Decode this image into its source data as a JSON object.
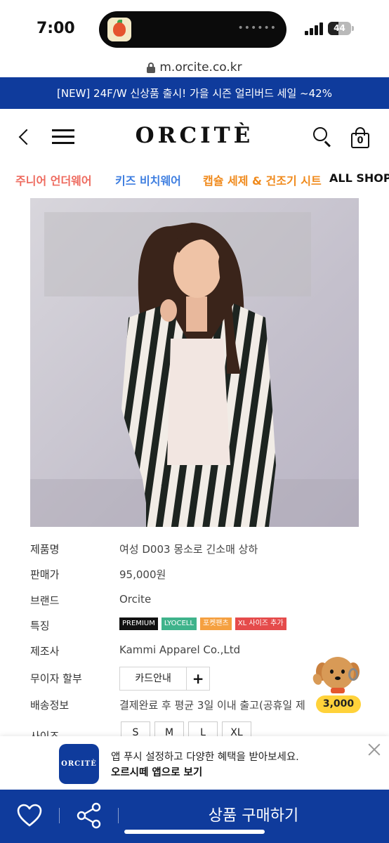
{
  "status_bar": {
    "time": "7:00",
    "battery": "44",
    "battery_fraction": 0.44
  },
  "browser": {
    "url": "m.orcite.co.kr"
  },
  "promo": {
    "text": "[NEW] 24F/W 신상품 출시! 가을 시즌 얼리버드 세일 ~42%"
  },
  "header": {
    "logo": "ORCITÈ",
    "cart_count": "0"
  },
  "categories": [
    {
      "label": "주니어 언더웨어",
      "color": "#ee6b5f"
    },
    {
      "label": "키즈 비치웨어",
      "color": "#3e7ee0"
    },
    {
      "label": "캡슐 세제 & 건조기 시트",
      "color": "#f08a1c"
    },
    {
      "label": "ALL SHOP",
      "color": "#111111"
    }
  ],
  "product": {
    "name_label": "제품명",
    "name": "여성 D003 몽소로 긴소매 상하",
    "price_label": "판매가",
    "price": "95,000원",
    "brand_label": "브랜드",
    "brand": "Orcite",
    "features_label": "특징",
    "features": [
      {
        "label": "PREMIUM",
        "color": "#111111"
      },
      {
        "label": "LYOCELL",
        "color": "#3fb38b"
      },
      {
        "label": "포켓팬츠",
        "color": "#f5a040"
      },
      {
        "label": "XL 사이즈 추가",
        "color": "#e54b4b"
      }
    ],
    "maker_label": "제조사",
    "maker": "Kammi Apparel Co.,Ltd",
    "installment_label": "무이자 할부",
    "card_button": "카드안내",
    "plus_symbol": "+",
    "shipping_label": "배송정보",
    "shipping": "결제완료 후 평균 3일 이내 출고(공휴일 제",
    "size_label": "사이즈",
    "sizes": [
      "S",
      "M",
      "L",
      "XL"
    ]
  },
  "mascot": {
    "points": "3,000"
  },
  "app_prompt": {
    "logo": "ORCITÈ",
    "message": "앱 푸시 설정하고 다양한 혜택을 받아보세요.",
    "link": "오르시떼 앱으로 보기"
  },
  "bottom_bar": {
    "buy_label": "상품 구매하기"
  },
  "colors": {
    "brand": "#0f3b9c",
    "points_badge": "#ffd23a"
  }
}
